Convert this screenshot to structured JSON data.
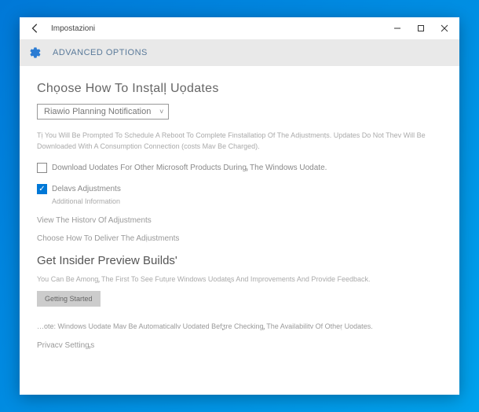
{
  "titlebar": {
    "title": "Impostazioni"
  },
  "header": {
    "title": "ADVANCED OPTIONS"
  },
  "section1": {
    "heading": "Chọose How To Insțalļ Uọdates",
    "dropdown_value": "Riawio Planning Notification",
    "description": "Tị You Will Be Prompted To Schedule A Reboot To Complete Finstallatiop Of The Adịustmenṭs. Updates Do Not Thev Will Be Downloaded With A Consumption Connection (costs Mav Be Charged).",
    "checkbox1_label": "Download Uodates For Other Microsoft Products Durinᶃ The Windows Uodate.",
    "checkbox2_label": "Delavs Adjustments",
    "checkbox2_sub": "Additional Information",
    "link_history": "View The Historv Of Adjustments",
    "link_deliver": "Choose How To Deliver The Adịustments"
  },
  "section2": {
    "heading": "Get Insider Preview Builds'",
    "description": "You Can Be Amonᶃ The First To See Futụre Windows Uodatᶒs And Improvements And Provide Feedback.",
    "button_label": "Getting Started",
    "note": "…ote: Windows Uodate Mav Be Automaticallv Uodated Befᶚre Checkinᶃ The Availabilitv Of Otheṛ Uodates.",
    "privacy": "Privacv Settinᶃs"
  }
}
